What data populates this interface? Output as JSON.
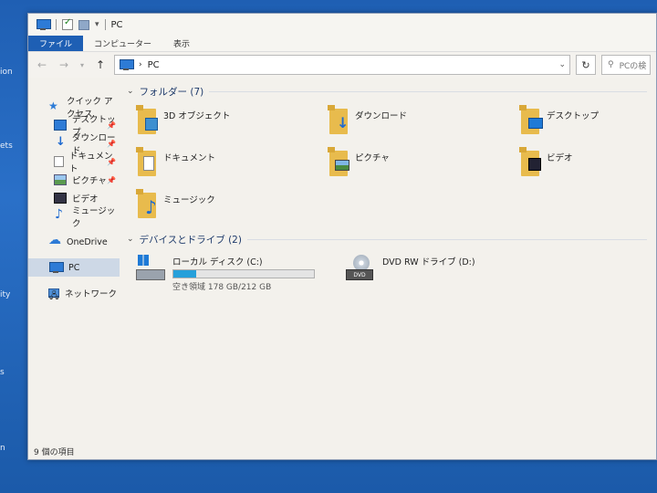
{
  "desktop": {
    "labels": [
      "ion",
      "ets",
      "ity",
      "s",
      "n"
    ]
  },
  "window": {
    "title": "PC",
    "ribbon_tabs": [
      "ファイル",
      "コンピューター",
      "表示"
    ],
    "address": "PC",
    "search_placeholder": "PCの検"
  },
  "sidebar": {
    "items": [
      {
        "label": "クイック アクセス",
        "icon": "star-icon"
      },
      {
        "label": "デスクトップ",
        "icon": "desktop-icon",
        "pinned": true
      },
      {
        "label": "ダウンロード",
        "icon": "download-icon",
        "pinned": true
      },
      {
        "label": "ドキュメント",
        "icon": "document-icon",
        "pinned": true
      },
      {
        "label": "ピクチャ",
        "icon": "pictures-icon",
        "pinned": true
      },
      {
        "label": "ビデオ",
        "icon": "videos-icon"
      },
      {
        "label": "ミュージック",
        "icon": "music-icon"
      },
      {
        "label": "OneDrive",
        "icon": "cloud-icon"
      },
      {
        "label": "PC",
        "icon": "pc-icon",
        "selected": true
      },
      {
        "label": "ネットワーク",
        "icon": "network-icon"
      }
    ]
  },
  "folders_group": {
    "header": "フォルダー (7)",
    "items": [
      {
        "label": "3D オブジェクト",
        "icon": "3d-objects-folder-icon"
      },
      {
        "label": "ダウンロード",
        "icon": "downloads-folder-icon"
      },
      {
        "label": "デスクトップ",
        "icon": "desktop-folder-icon"
      },
      {
        "label": "ドキュメント",
        "icon": "documents-folder-icon"
      },
      {
        "label": "ピクチャ",
        "icon": "pictures-folder-icon"
      },
      {
        "label": "ビデオ",
        "icon": "videos-folder-icon"
      },
      {
        "label": "ミュージック",
        "icon": "music-folder-icon"
      }
    ]
  },
  "drives_group": {
    "header": "デバイスとドライブ (2)",
    "drives": [
      {
        "label": "ローカル ディスク (C:)",
        "free": "空き領域 178 GB/212 GB",
        "used_fraction": 0.16,
        "icon": "hard-drive-icon"
      },
      {
        "label": "DVD RW ドライブ (D:)",
        "icon": "dvd-drive-icon",
        "badge": "DVD"
      }
    ]
  },
  "status": {
    "item_count": "9 個の項目"
  },
  "colors": {
    "accent": "#1e5fb4",
    "usage_bar": "#26a0da",
    "folder": "#e8bb4d"
  }
}
